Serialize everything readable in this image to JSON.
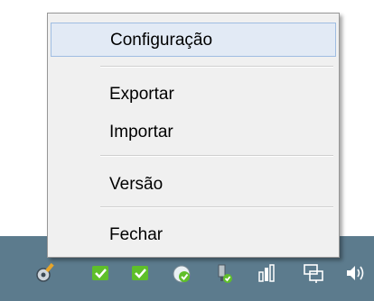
{
  "menu": {
    "items": [
      {
        "label": "Configuração",
        "selected": true
      },
      {
        "label": "Exportar"
      },
      {
        "label": "Importar"
      },
      {
        "label": "Versão"
      },
      {
        "label": "Fechar"
      }
    ]
  },
  "tray": {
    "icons": [
      "settings-gear-icon",
      "green-check-icon",
      "green-check-icon-2",
      "sync-check-icon",
      "plug-check-icon",
      "signal-bars-icon",
      "network-icon",
      "volume-icon"
    ]
  },
  "colors": {
    "taskbar": "#5c7b8d",
    "menu_background": "#f0f0f0",
    "selection": "#e2eaf5",
    "selection_border": "#9fbde2",
    "check_green": "#5fbf2a"
  }
}
